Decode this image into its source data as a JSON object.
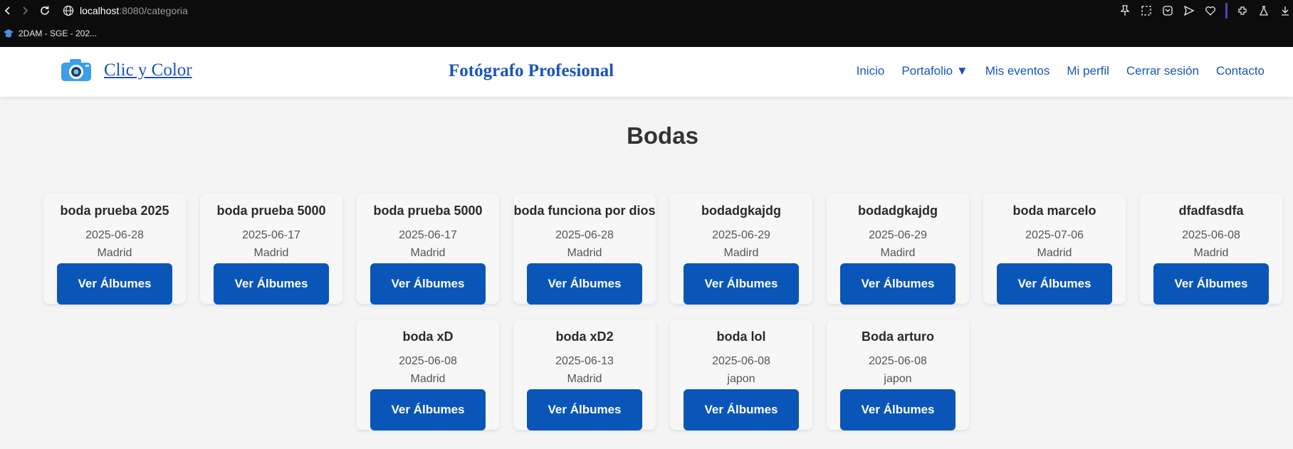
{
  "browser": {
    "url_host": "localhost",
    "url_path": ":8080/categoria",
    "bookmark": "2DAM - SGE - 202..."
  },
  "site": {
    "brand": "Clic y Color",
    "title": "Fotógrafo Profesional",
    "nav": [
      "Inicio",
      "Portafolio ▼",
      "Mis eventos",
      "Mi perfil",
      "Cerrar sesión",
      "Contacto"
    ]
  },
  "page": {
    "heading": "Bodas"
  },
  "cards": [
    {
      "name": "boda prueba 2025",
      "date": "2025-06-28",
      "place": "Madrid",
      "button": "Ver Álbumes"
    },
    {
      "name": "boda prueba 5000",
      "date": "2025-06-17",
      "place": "Madrid",
      "button": "Ver Álbumes"
    },
    {
      "name": "boda prueba 5000",
      "date": "2025-06-17",
      "place": "Madrid",
      "button": "Ver Álbumes"
    },
    {
      "name": "boda funciona por dios",
      "date": "2025-06-28",
      "place": "Madrid",
      "button": "Ver Álbumes"
    },
    {
      "name": "bodadgkajdg",
      "date": "2025-06-29",
      "place": "Madird",
      "button": "Ver Álbumes"
    },
    {
      "name": "bodadgkajdg",
      "date": "2025-06-29",
      "place": "Madird",
      "button": "Ver Álbumes"
    },
    {
      "name": "boda marcelo",
      "date": "2025-07-06",
      "place": "Madrid",
      "button": "Ver Álbumes"
    },
    {
      "name": "dfadfasdfa",
      "date": "2025-06-08",
      "place": "Madrid",
      "button": "Ver Álbumes"
    },
    {
      "name": "boda xD",
      "date": "2025-06-08",
      "place": "Madrid",
      "button": "Ver Álbumes"
    },
    {
      "name": "boda xD2",
      "date": "2025-06-13",
      "place": "Madrid",
      "button": "Ver Álbumes"
    },
    {
      "name": "boda lol",
      "date": "2025-06-08",
      "place": "japon",
      "button": "Ver Álbumes"
    },
    {
      "name": "Boda arturo",
      "date": "2025-06-08",
      "place": "japon",
      "button": "Ver Álbumes"
    }
  ],
  "colors": {
    "brand_blue": "#1a55b8",
    "button_blue": "#0a56b8",
    "chrome_bg": "#0c0c0d",
    "page_bg": "#f4f4f4"
  }
}
